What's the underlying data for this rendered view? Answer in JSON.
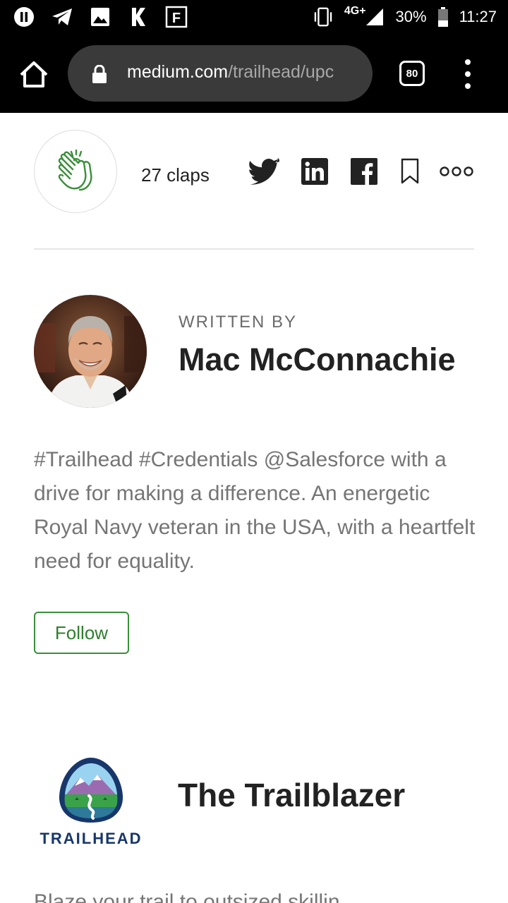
{
  "status_bar": {
    "network": "4G+",
    "battery": "30%",
    "time": "11:27",
    "icons": [
      "pause-icon",
      "telegram-icon",
      "gallery-icon",
      "k-app-icon",
      "f-app-icon",
      "vibrate-icon",
      "signal-icon",
      "battery-icon"
    ]
  },
  "browser": {
    "url_domain": "medium.com",
    "url_path": "/trailhead/upc",
    "tab_count": "80"
  },
  "article": {
    "claps": "27 claps",
    "share_icons": [
      "twitter-icon",
      "linkedin-icon",
      "facebook-icon",
      "bookmark-icon",
      "more-icon"
    ]
  },
  "author": {
    "written_by": "WRITTEN BY",
    "name": "Mac McConnachie",
    "bio": "#Trailhead #Credentials @Salesforce with a drive for making a difference. An energetic Royal Navy veteran in the USA, with a heartfelt need for equality.",
    "follow_label": "Follow"
  },
  "publication": {
    "logo_word": "TRAILHEAD",
    "title": "The Trailblazer",
    "cut_text": "Blaze your trail to outsized skillin"
  },
  "colors": {
    "accent_green": "#3a8f3a",
    "trailhead_navy": "#17376b"
  }
}
